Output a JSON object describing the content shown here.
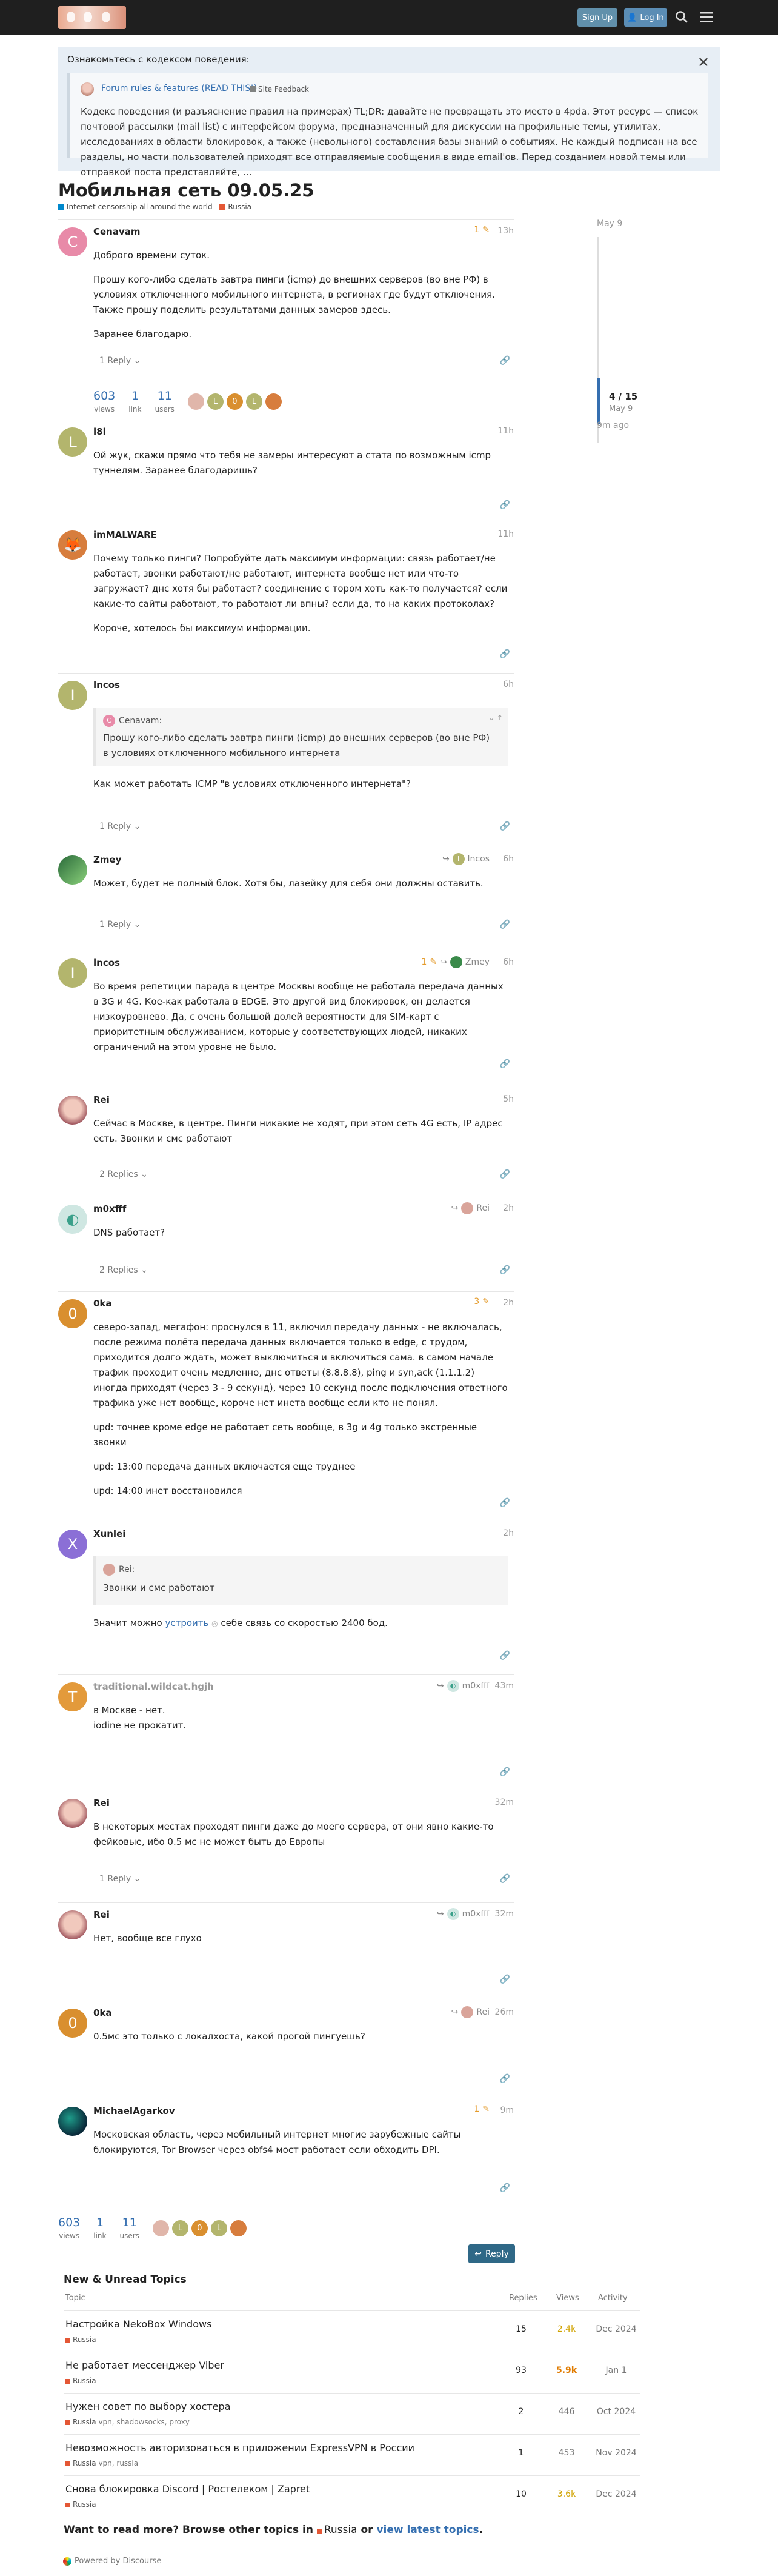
{
  "header": {
    "signup": "Sign Up",
    "login": "Log In"
  },
  "banner": {
    "title": "Ознакомьтесь с кодексом поведения:",
    "link": "Forum rules & features (READ THIS!)",
    "category": "Site Feedback",
    "text": "Кодекс поведения (и разъяснение правил на примерах) TL;DR: давайте не превращать это место в 4pda. Этот ресурс — список почтовой рассылки (mail list) с интерфейсом форума, предназначенный для дискуссии на профильные темы, утилитах, исследованиях в области блокировок, а также (невольного) составления базы знаний о событиях. Не каждый подписан на все разделы, но части пользователей приходят все отправляемые сообщения в виде email'ов. Перед созданием новой темы или отправкой поста представляйте, …"
  },
  "topic": {
    "title": "Мобильная сеть 09.05.25",
    "categories": [
      {
        "name": "Internet censorship all around the world",
        "color": "#0088cc"
      },
      {
        "name": "Russia",
        "color": "#e45735"
      }
    ]
  },
  "timeline": {
    "top_date": "May 9",
    "count": "4 / 15",
    "current_date": "May 9",
    "ago": "9m ago"
  },
  "posts": [
    {
      "user": "Cenavam",
      "letter": "C",
      "date": "13h",
      "edit": "1",
      "p": [
        "Доброго времени суток.",
        "Прошу кого-либо сделать завтра пинги (icmp) до внешних серверов (во вне РФ) в условиях отключенного мобильного интернета, в регионах где будут отключения. Также прошу поделить результатами данных замеров здесь.",
        "Заранее благодарю."
      ],
      "replies": "1 Reply"
    },
    {
      "user": "l8l",
      "letter": "L",
      "date": "11h",
      "p": [
        "Ой жук, скажи прямо что тебя не замеры интересуют а стата по возможным icmp туннелям. Заранее благодаришь?"
      ]
    },
    {
      "user": "imMALWARE",
      "date": "11h",
      "p": [
        "Почему только пинги? Попробуйте дать максимум информации: связь работает/не работает, звонки работают/не работают, интернета вообще нет или что-то загружает? днс хотя бы работает? соединение с тором хоть как-то получается? если какие-то сайты работают, то работают ли впны? если да, то на каких протоколах?",
        "Короче, хотелось бы максимум информации."
      ]
    },
    {
      "user": "lncos",
      "letter": "I",
      "date": "6h",
      "quote_user": "Cenavam:",
      "quote": "Прошу кого-либо сделать завтра пинги (icmp) до внешних серверов (во вне РФ) в условиях отключенного мобильного интернета",
      "p": [
        "Как может работать ICMP \"в условиях отключенного интернета\"?"
      ],
      "replies": "1 Reply"
    },
    {
      "user": "Zmey",
      "date": "6h",
      "reply_to": "lncos",
      "p": [
        "Может, будет не полный блок. Хотя бы, лазейку для себя они должны оставить."
      ],
      "replies": "1 Reply"
    },
    {
      "user": "lncos",
      "letter": "I",
      "date": "6h",
      "edit": "1",
      "reply_to": "Zmey",
      "p": [
        "Во время репетиции парада в центре Москвы вообще не работала передача данных в 3G и 4G. Кое-как работала в EDGE. Это другой вид блокировок, он делается низкоуровнево. Да, с очень большой долей вероятности для SIM-карт с приоритетным обслуживанием, которые у соответствующих людей, никаких ограничений на этом уровне не было."
      ]
    },
    {
      "user": "Rei",
      "date": "5h",
      "p": [
        "Сейчас в Москве, в центре. Пинги никакие не ходят, при этом сеть 4G есть, IP адрес есть. Звонки и смс работают"
      ],
      "replies": "2 Replies"
    },
    {
      "user": "m0xfff",
      "date": "2h",
      "reply_to": "Rei",
      "p": [
        "DNS работает?"
      ],
      "replies": "2 Replies"
    },
    {
      "user": "0ka",
      "letter": "0",
      "date": "2h",
      "edit": "3",
      "p": [
        "северо-запад, мегафон: проснулся в 11, включил передачу данных - не включалась, после режима полёта передача данных включается только в edge, с трудом, приходится долго ждать, может выключиться и включиться сама. в самом начале трафик проходит очень медленно, днс ответы (8.8.8.8), ping и syn,ack (1.1.1.2) иногда приходят (через 3 - 9 секунд), через 10 секунд после подключения ответного трафика уже нет вообще, короче нет инета вообще если кто не понял.",
        "upd: точнее кроме edge не работает сеть вообще, в 3g и 4g только экстренные звонки",
        "upd: 13:00 передача данных включается еще труднее",
        "upd: 14:00 инет восстановился"
      ]
    },
    {
      "user": "Xunlei",
      "letter": "X",
      "date": "2h",
      "quote_user": "Rei:",
      "quote": "Звонки и смс работают",
      "p_prefix": "Значит можно ",
      "p_link": "устроить",
      "p_suffix": " себе связь со скоростью 2400 бод."
    },
    {
      "user": "traditional.wildcat.hgjh",
      "letter": "T",
      "date": "43m",
      "reply_to": "m0xfff",
      "p": [
        "в Москве - нет.\niodine не прокатит."
      ]
    },
    {
      "user": "Rei",
      "date": "32m",
      "p": [
        "В некоторых местах проходят пинги даже до моего сервера, от они явно какие-то фейковые, ибо 0.5 мс не может быть до Европы"
      ],
      "replies": "1 Reply"
    },
    {
      "user": "Rei",
      "date": "32m",
      "reply_to": "m0xfff",
      "p": [
        "Нет, вообще все глухо"
      ]
    },
    {
      "user": "0ka",
      "letter": "0",
      "date": "26m",
      "reply_to": "Rei",
      "p": [
        "0.5мс это только с локалхоста, какой прогой пингуешь?"
      ]
    },
    {
      "user": "MichaelAgarkov",
      "date": "9m",
      "edit": "1",
      "p": [
        "Московская область, через мобильный интернет многие зарубежные сайты блокируются, Tor Browser через obfs4 мост работает если обходить DPI."
      ]
    }
  ],
  "first_stats": {
    "views": "603",
    "views_label": "views",
    "link": "1",
    "link_label": "link",
    "users": "11",
    "users_label": "users"
  },
  "bottom_stats": {
    "views": "603",
    "views_label": "views",
    "link": "1",
    "link_label": "link",
    "users": "11",
    "users_label": "users"
  },
  "reply_button": "Reply",
  "new_topics": {
    "title": "New & Unread Topics",
    "headers": {
      "topic": "Topic",
      "replies": "Replies",
      "views": "Views",
      "activity": "Activity"
    },
    "rows": [
      {
        "title": "Настройка NekoBox Windows",
        "category": "Russia",
        "tags": "",
        "replies": "15",
        "views": "2.4k",
        "views_color": "#d0a200",
        "activity": "Dec 2024"
      },
      {
        "title": "Не работает мессенджер Viber",
        "category": "Russia",
        "tags": "",
        "replies": "93",
        "views": "5.9k",
        "views_color": "#e07b00",
        "activity": "Jan 1"
      },
      {
        "title": "Нужен совет по выбору хостера",
        "category": "Russia",
        "tags": "vpn, shadowsocks, proxy",
        "replies": "2",
        "views": "446",
        "views_color": "#777777",
        "activity": "Oct 2024"
      },
      {
        "title": "Невозможность авторизоваться в приложении ExpressVPN в России",
        "category": "Russia",
        "tags": "vpn, russia",
        "replies": "1",
        "views": "453",
        "views_color": "#777777",
        "activity": "Nov 2024"
      },
      {
        "title": "Снова блокировка Discord | Ростелеком | Zapret",
        "category": "Russia",
        "tags": "",
        "replies": "10",
        "views": "3.6k",
        "views_color": "#d0a200",
        "activity": "Dec 2024"
      }
    ]
  },
  "more": {
    "prefix": "Want to read more? Browse other topics in ",
    "category": "Russia",
    "middle": " or ",
    "link": "view latest topics",
    "suffix": "."
  },
  "powered": "Powered by Discourse",
  "colors": {
    "accent": "#356fb0",
    "header_bg": "#1f1f1f",
    "russia": "#e45735",
    "global": "#0088cc"
  }
}
